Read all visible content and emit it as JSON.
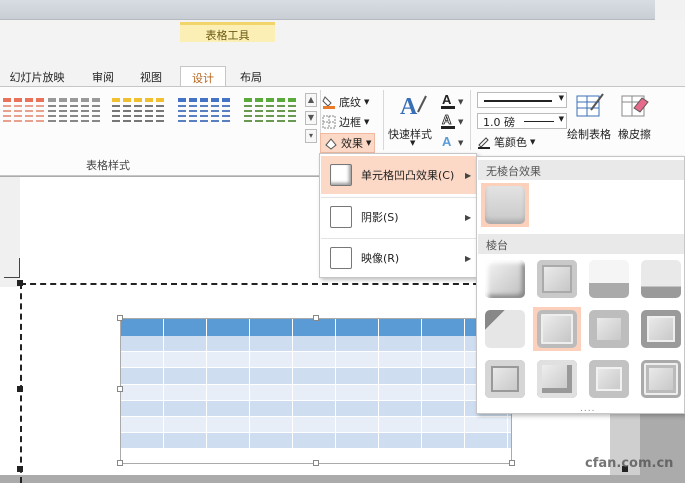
{
  "window": {
    "context_group": "表格工具"
  },
  "tabs": [
    {
      "label": "幻灯片放映"
    },
    {
      "label": "审阅"
    },
    {
      "label": "视图"
    },
    {
      "label": "设计",
      "active": true
    },
    {
      "label": "布局"
    }
  ],
  "ribbon": {
    "group_table_styles": "表格样式",
    "shading": "底纹",
    "border": "边框",
    "effects": "效果",
    "quick_styles": "快速样式",
    "pen_weight": "1.0 磅",
    "pen_color": "笔颜色",
    "draw_table": "绘制表格",
    "eraser": "橡皮擦"
  },
  "effects_menu": {
    "items": [
      {
        "label": "单元格凹凸效果(C)",
        "active": true
      },
      {
        "label": "阴影(S)"
      },
      {
        "label": "映像(R)"
      }
    ]
  },
  "bevel_panel": {
    "section_none": "无棱台效果",
    "section_bevel": "棱台",
    "more": "...."
  },
  "watermark": "cfan.com.cn",
  "colors": {
    "accent_orange": "#fcd8c6",
    "selected_bevel": "#fcd0bb",
    "table_header": "#5b9bd5",
    "context_tab": "#fcefb6"
  }
}
